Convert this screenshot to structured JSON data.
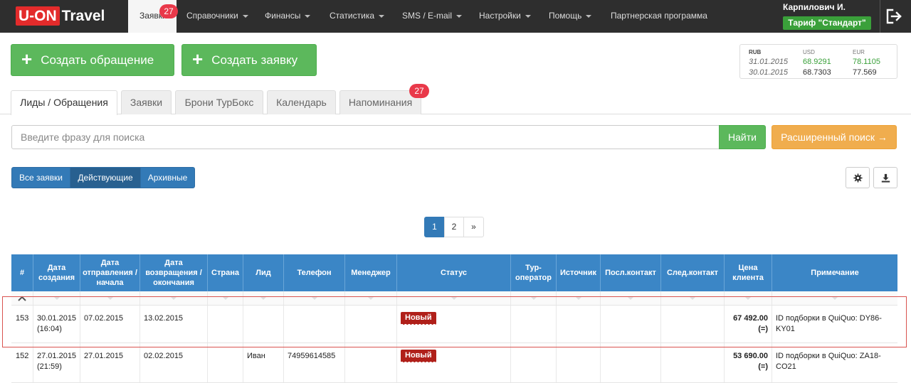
{
  "navbar": {
    "logo_uon": "U-ON",
    "logo_travel": "Travel",
    "items": [
      {
        "label": "Заявки",
        "badge": "27"
      },
      {
        "label": "Справочники"
      },
      {
        "label": "Финансы"
      },
      {
        "label": "Статистика"
      },
      {
        "label": "SMS / E-mail"
      },
      {
        "label": "Настройки"
      },
      {
        "label": "Помощь"
      },
      {
        "label": "Партнерская программа"
      }
    ],
    "user": "Карпилович И.",
    "tariff": "Тариф \"Стандарт\""
  },
  "actions": {
    "create_appeal": "Создать обращение",
    "create_request": "Создать заявку",
    "plus": "+"
  },
  "currency": {
    "headers": [
      "RUB",
      "USD",
      "EUR"
    ],
    "rows": [
      {
        "date": "31.01.2015",
        "usd": "68.9291",
        "eur": "78.1105"
      },
      {
        "date": "30.01.2015",
        "usd": "68.7303",
        "eur": "77.569"
      }
    ],
    "accent": "#3aa03a"
  },
  "tabs": [
    {
      "label": "Лиды / Обращения"
    },
    {
      "label": "Заявки"
    },
    {
      "label": "Брони ТурБокс"
    },
    {
      "label": "Календарь"
    },
    {
      "label": "Напоминания",
      "badge": "27"
    }
  ],
  "search": {
    "placeholder": "Введите фразу для поиска",
    "find": "Найти",
    "advanced": "Расширенный поиск →"
  },
  "filters": [
    "Все заявки",
    "Действующие",
    "Архивные"
  ],
  "pagination": [
    "1",
    "2",
    "»"
  ],
  "table": {
    "columns": [
      "#",
      "Дата создания",
      "Дата отправления / начала",
      "Дата возвращения / окончания",
      "Страна",
      "Лид",
      "Телефон",
      "Менеджер",
      "Статус",
      "Тур-оператор",
      "Источник",
      "Посл.контакт",
      "След.контакт",
      "Цена клиента",
      "Примечание"
    ],
    "rows": [
      {
        "id": "153",
        "created": "30.01.2015",
        "created_time": "(16:04)",
        "start": "07.02.2015",
        "end": "13.02.2015",
        "country": "",
        "lead": "",
        "phone": "",
        "manager": "",
        "status": "Новый",
        "operator": "",
        "source": "",
        "last_contact": "",
        "next_contact": "",
        "price": "67 492.00",
        "price_note": "(=)",
        "note": "ID подборки в QuiQuo: DY86-KY01"
      },
      {
        "id": "152",
        "created": "27.01.2015",
        "created_time": "(21:59)",
        "start": "27.01.2015",
        "end": "02.02.2015",
        "country": "",
        "lead": "Иван",
        "phone": "74959614585",
        "manager": "",
        "status": "Новый",
        "operator": "",
        "source": "",
        "last_contact": "",
        "next_contact": "",
        "price": "53 690.00",
        "price_note": "(=)",
        "note": "ID подборки в QuiQuo: ZA18-CO21"
      }
    ]
  }
}
